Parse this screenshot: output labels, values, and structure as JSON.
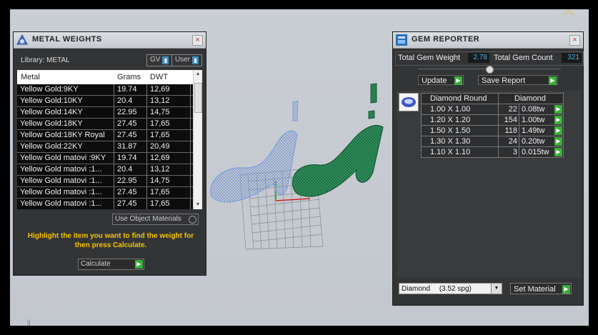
{
  "metal_panel": {
    "title": "METAL WEIGHTS",
    "library_label": "Library: METAL",
    "gv_label": "GV",
    "user_label": "User",
    "columns": [
      "Metal",
      "Grams",
      "DWT"
    ],
    "rows": [
      [
        "Yellow Gold:9KY",
        "19.74",
        "12,69"
      ],
      [
        "Yellow Gold:10KY",
        "20.4",
        "13,12"
      ],
      [
        "Yellow Gold:14KY",
        "22.95",
        "14,75"
      ],
      [
        "Yellow Gold:18KY",
        "27.45",
        "17,65"
      ],
      [
        "Yellow Gold:18KY Royal",
        "27.45",
        "17,65"
      ],
      [
        "Yellow Gold:22KY",
        "31.87",
        "20,49"
      ],
      [
        "Yellow Gold matovi :9KY",
        "19.74",
        "12,69"
      ],
      [
        "Yellow Gold matovi :1...",
        "20.4",
        "13,12"
      ],
      [
        "Yellow Gold matovi :1...",
        "22.95",
        "14,75"
      ],
      [
        "Yellow Gold matovi :1...",
        "27.45",
        "17,65"
      ],
      [
        "Yellow Gold matovi :1...",
        "27.45",
        "17,65"
      ]
    ],
    "use_object_materials": "Use Object Materials",
    "hint": "Highlight the item you want to find the weight for then press Calculate.",
    "calculate_label": "Calculate"
  },
  "gem_panel": {
    "title": "GEM REPORTER",
    "total_gem_weight_label": "Total Gem Weight",
    "total_gem_weight": "2.78",
    "total_gem_count_label": "Total Gem Count",
    "total_gem_count": "321",
    "update_label": "Update",
    "save_report_label": "Save Report",
    "columns": [
      "Diamond Round",
      "Diamond"
    ],
    "rows": [
      [
        "1.00 X 1.00",
        "22",
        "0.08tw"
      ],
      [
        "1.20 X 1.20",
        "154",
        "1.00tw"
      ],
      [
        "1.50 X 1.50",
        "118",
        "1.49tw"
      ],
      [
        "1.30 X 1.30",
        "24",
        "0.20tw"
      ],
      [
        "1.10 X 1.10",
        "3",
        "0.015tw"
      ]
    ],
    "material_select": "Diamond",
    "material_spg": "(3.52 spg)",
    "set_material_label": "Set Material"
  },
  "colors": {
    "viewport_bg": "#c6cbd1",
    "panel_bg": "#333436",
    "accent_green": "#3cae3a",
    "accent_blue": "#49b3e0",
    "hint_yellow": "#f5c400",
    "mesh_blue": "#8fb3e8",
    "mesh_green": "#1f7a4a"
  }
}
